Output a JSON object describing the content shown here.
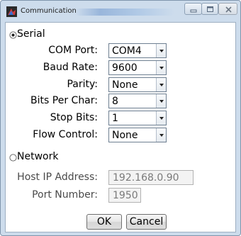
{
  "window": {
    "title": "Communication"
  },
  "serial": {
    "label": "Serial",
    "selected": true,
    "fields": [
      {
        "label": "COM Port:",
        "value": "COM4"
      },
      {
        "label": "Baud Rate:",
        "value": "9600"
      },
      {
        "label": "Parity:",
        "value": "None"
      },
      {
        "label": "Bits Per Char:",
        "value": "8"
      },
      {
        "label": "Stop Bits:",
        "value": "1"
      },
      {
        "label": "Flow Control:",
        "value": "None"
      }
    ]
  },
  "network": {
    "label": "Network",
    "selected": false,
    "host_ip_label": "Host IP Address:",
    "host_ip_value": "192.168.0.90",
    "port_label": "Port Number:",
    "port_value": "1950"
  },
  "buttons": {
    "ok": "OK",
    "cancel": "Cancel"
  }
}
